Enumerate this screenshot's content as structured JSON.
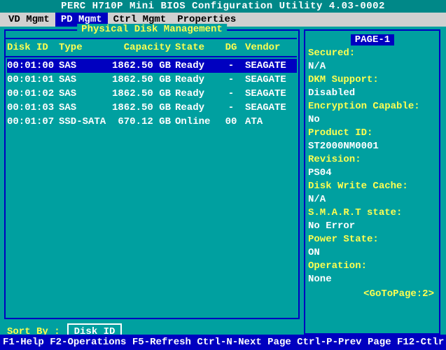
{
  "title": "PERC H710P Mini BIOS Configuration Utility 4.03-0002",
  "menu": {
    "items": [
      {
        "label": "VD Mgmt",
        "active": false
      },
      {
        "label": "PD Mgmt",
        "active": true
      },
      {
        "label": "Ctrl Mgmt",
        "active": false
      },
      {
        "label": "Properties",
        "active": false
      }
    ]
  },
  "left": {
    "panel_title": "Physical Disk Management",
    "headers": {
      "id": "Disk ID",
      "type": "Type",
      "capacity": "Capacity",
      "state": "State",
      "dg": "DG",
      "vendor": "Vendor"
    },
    "rows": [
      {
        "id": "00:01:00",
        "type": "SAS",
        "capacity": "1862.50 GB",
        "state": "Ready",
        "dg": "-",
        "vendor": "SEAGATE",
        "selected": true
      },
      {
        "id": "00:01:01",
        "type": "SAS",
        "capacity": "1862.50 GB",
        "state": "Ready",
        "dg": "-",
        "vendor": "SEAGATE",
        "selected": false
      },
      {
        "id": "00:01:02",
        "type": "SAS",
        "capacity": "1862.50 GB",
        "state": "Ready",
        "dg": "-",
        "vendor": "SEAGATE",
        "selected": false
      },
      {
        "id": "00:01:03",
        "type": "SAS",
        "capacity": "1862.50 GB",
        "state": "Ready",
        "dg": "-",
        "vendor": "SEAGATE",
        "selected": false
      },
      {
        "id": "00:01:07",
        "type": "SSD-SATA",
        "capacity": "670.12 GB",
        "state": "Online",
        "dg": "00",
        "vendor": "ATA",
        "selected": false
      }
    ],
    "sort_label": "Sort By :",
    "sort_value": "Disk ID"
  },
  "right": {
    "page_indicator": "PAGE-1",
    "props": [
      {
        "k": "Secured:",
        "v": "N/A"
      },
      {
        "k": "DKM Support:",
        "v": "Disabled"
      },
      {
        "k": "Encryption Capable:",
        "v": "No"
      },
      {
        "k": "Product ID:",
        "v": "ST2000NM0001"
      },
      {
        "k": "Revision:",
        "v": "PS04"
      },
      {
        "k": "Disk Write Cache:",
        "v": "N/A"
      },
      {
        "k": "S.M.A.R.T state:",
        "v": "No Error"
      },
      {
        "k": "Power State:",
        "v": "ON"
      },
      {
        "k": "Operation:",
        "v": "None"
      }
    ],
    "goto": "<GoToPage:2>"
  },
  "help": {
    "f1k": "F1",
    "f1a": "-Help ",
    "f2k": "F2",
    "f2a": "-Operations ",
    "f5k": "F5",
    "f5a": "-Refresh ",
    "cnk": "Ctrl-N",
    "cna": "-Next Page ",
    "cpk": "Ctrl-P",
    "cpa": "-Prev Page ",
    "f12k": "F12",
    "f12a": "-Ctlr"
  }
}
